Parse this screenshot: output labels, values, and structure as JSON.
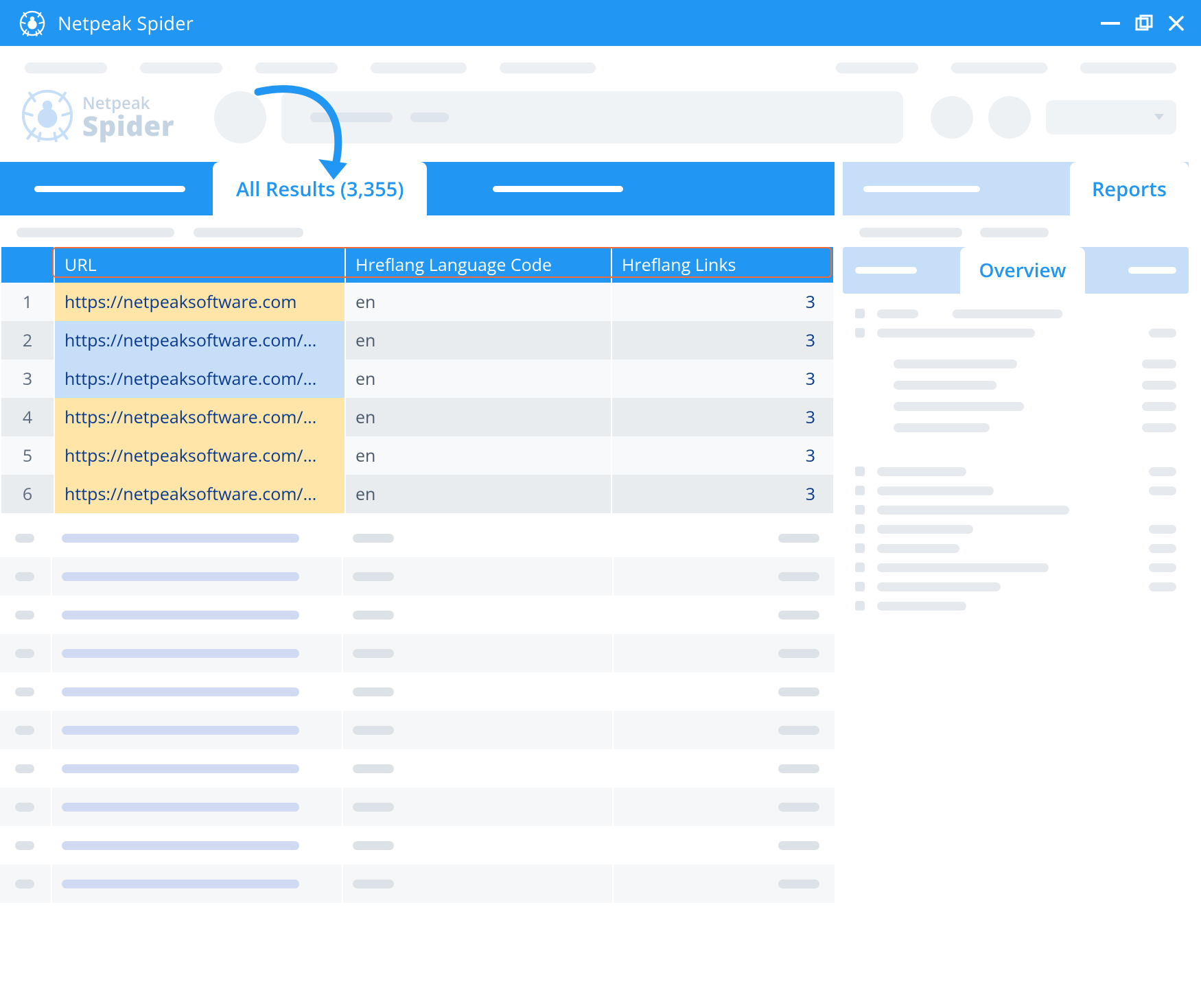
{
  "app": {
    "title": "Netpeak Spider",
    "logo": {
      "line1": "Netpeak",
      "line2": "Spider"
    }
  },
  "main_tabs": {
    "active_label": "All Results (3,355)"
  },
  "table": {
    "columns": {
      "url": "URL",
      "lang": "Hreflang Language Code",
      "links": "Hreflang Links"
    },
    "rows": [
      {
        "idx": "1",
        "url": "https://netpeaksoftware.com",
        "lang": "en",
        "links": "3",
        "url_hl": true
      },
      {
        "idx": "2",
        "url": "https://netpeaksoftware.com/...",
        "lang": "en",
        "links": "3",
        "url_hl": false
      },
      {
        "idx": "3",
        "url": "https://netpeaksoftware.com/...",
        "lang": "en",
        "links": "3",
        "url_hl": false
      },
      {
        "idx": "4",
        "url": "https://netpeaksoftware.com/...",
        "lang": "en",
        "links": "3",
        "url_hl": true
      },
      {
        "idx": "5",
        "url": "https://netpeaksoftware.com/...",
        "lang": "en",
        "links": "3",
        "url_hl": true
      },
      {
        "idx": "6",
        "url": "https://netpeaksoftware.com/...",
        "lang": "en",
        "links": "3",
        "url_hl": true
      }
    ]
  },
  "side": {
    "reports_label": "Reports",
    "overview_label": "Overview"
  },
  "colors": {
    "brand": "#2196f3",
    "highlight_border": "#f26b3a",
    "url_yellow": "#ffe5a8",
    "url_blue": "#c7def8"
  }
}
